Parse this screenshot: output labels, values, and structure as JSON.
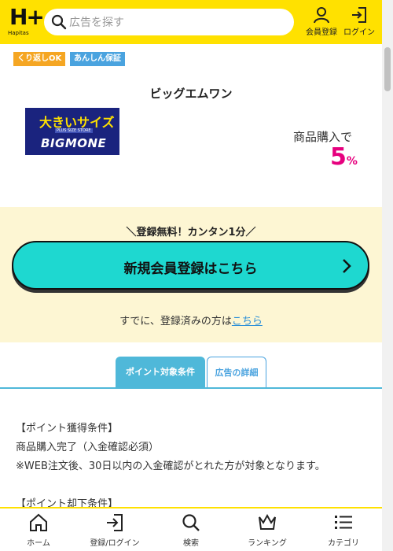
{
  "header": {
    "logo_mark": "H+",
    "logo_sub": "Hapitas",
    "search_placeholder": "広告を探す",
    "register_label": "会員登録",
    "login_label": "ログイン"
  },
  "badges": [
    "くり返しOK",
    "あんしん保証"
  ],
  "shop": {
    "name": "ビッグエムワン",
    "logo_text": "大きいサイズ",
    "logo_small": "PLUS SIZE STORE",
    "logo_brand": "BIGMONE",
    "rate_label": "商品購入で",
    "rate_value": "5",
    "rate_unit": "%"
  },
  "register": {
    "catch": "＼登録無料！カンタン1分／",
    "cta_label": "新規会員登録はこちら",
    "already_text": "すでに、登録済みの方は",
    "already_link": "こちら"
  },
  "tabs": [
    "ポイント対象条件",
    "広告の詳細"
  ],
  "content": {
    "line1": "【ポイント獲得条件】",
    "line2": "商品購入完了（入金確認必須）",
    "line3": "※WEB注文後、30日以内の入金確認がとれた方が対象となります。",
    "line4": "【ポイント却下条件】"
  },
  "bottom_nav": [
    "ホーム",
    "登録/ログイン",
    "検索",
    "ランキング",
    "カテゴリ"
  ],
  "colors": {
    "header_bg": "#ffe100",
    "cta_bg": "#1ed8d0",
    "rate_color": "#e6007e",
    "tab_active": "#4fb8d9",
    "register_band": "#fdf6d3"
  }
}
